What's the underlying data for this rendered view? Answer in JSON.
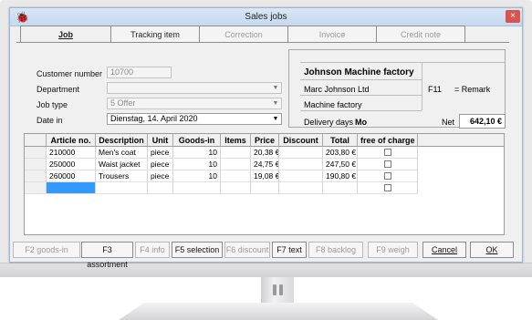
{
  "window": {
    "title": "Sales jobs",
    "close_label": "×"
  },
  "tabs": [
    {
      "label": "Job",
      "state": "active"
    },
    {
      "label": "Tracking item",
      "state": "enabled"
    },
    {
      "label": "Correction",
      "state": "disabled"
    },
    {
      "label": "Invoice",
      "state": "disabled"
    },
    {
      "label": "Credit note",
      "state": "disabled"
    }
  ],
  "form": {
    "customer_number": {
      "label": "Customer number",
      "value": "10700"
    },
    "department": {
      "label": "Department",
      "value": ""
    },
    "job_type": {
      "label": "Job type",
      "value": "5  Offer"
    },
    "date_in": {
      "label": "Date in",
      "value": "Dienstag, 14. April 2020"
    }
  },
  "customer_info": {
    "name": "Johnson Machine factory",
    "contact": "Marc Johnson Ltd",
    "company": "Machine factory",
    "shortcut": "F11",
    "remark": "= Remark",
    "delivery_days_label": "Delivery days",
    "delivery_days_value": "Mo",
    "net_label": "Net",
    "net_value": "642,10 €"
  },
  "table": {
    "headers": [
      "Article no.",
      "Description",
      "Unit",
      "Goods-in",
      "Items",
      "Price",
      "Discount",
      "Total",
      "free of charge"
    ],
    "rows": [
      [
        "210000",
        "Men's coat",
        "piece",
        "10",
        "",
        "20,38 €",
        "",
        "203,80 €",
        ""
      ],
      [
        "250000",
        "Waist jacket",
        "piece",
        "10",
        "",
        "24,75 €",
        "",
        "247,50 €",
        ""
      ],
      [
        "260000",
        "Trousers",
        "piece",
        "10",
        "",
        "19,08 €",
        "",
        "190,80 €",
        ""
      ]
    ]
  },
  "buttons": [
    {
      "label": "F2 goods-in",
      "enabled": false
    },
    {
      "label": "F3 assortment",
      "enabled": true
    },
    {
      "label": "F4 info",
      "enabled": false
    },
    {
      "label": "F5 selection",
      "enabled": true
    },
    {
      "label": "F6 discount",
      "enabled": false
    },
    {
      "label": "F7 text",
      "enabled": true
    },
    {
      "label": "F8 backlog",
      "enabled": false
    },
    {
      "label": "F9 weigh",
      "enabled": false
    },
    {
      "label": "Cancel",
      "enabled": true
    },
    {
      "label": "OK",
      "enabled": true
    }
  ]
}
